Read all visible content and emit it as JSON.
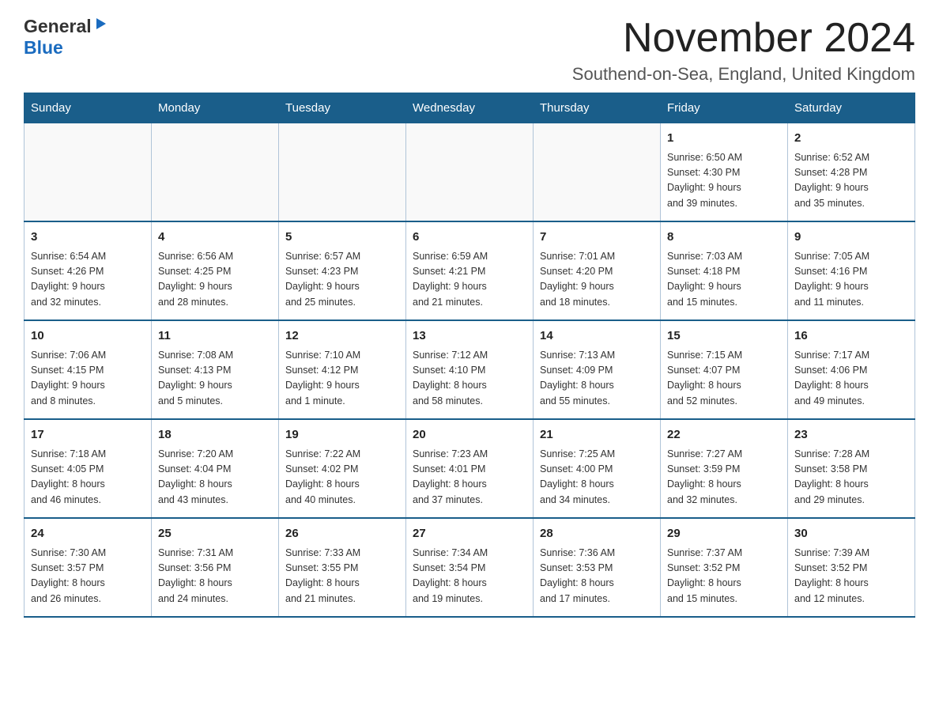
{
  "logo": {
    "line1": "General",
    "line2": "Blue"
  },
  "header": {
    "month": "November 2024",
    "location": "Southend-on-Sea, England, United Kingdom"
  },
  "days_of_week": [
    "Sunday",
    "Monday",
    "Tuesday",
    "Wednesday",
    "Thursday",
    "Friday",
    "Saturday"
  ],
  "weeks": [
    [
      {
        "day": "",
        "info": ""
      },
      {
        "day": "",
        "info": ""
      },
      {
        "day": "",
        "info": ""
      },
      {
        "day": "",
        "info": ""
      },
      {
        "day": "",
        "info": ""
      },
      {
        "day": "1",
        "info": "Sunrise: 6:50 AM\nSunset: 4:30 PM\nDaylight: 9 hours\nand 39 minutes."
      },
      {
        "day": "2",
        "info": "Sunrise: 6:52 AM\nSunset: 4:28 PM\nDaylight: 9 hours\nand 35 minutes."
      }
    ],
    [
      {
        "day": "3",
        "info": "Sunrise: 6:54 AM\nSunset: 4:26 PM\nDaylight: 9 hours\nand 32 minutes."
      },
      {
        "day": "4",
        "info": "Sunrise: 6:56 AM\nSunset: 4:25 PM\nDaylight: 9 hours\nand 28 minutes."
      },
      {
        "day": "5",
        "info": "Sunrise: 6:57 AM\nSunset: 4:23 PM\nDaylight: 9 hours\nand 25 minutes."
      },
      {
        "day": "6",
        "info": "Sunrise: 6:59 AM\nSunset: 4:21 PM\nDaylight: 9 hours\nand 21 minutes."
      },
      {
        "day": "7",
        "info": "Sunrise: 7:01 AM\nSunset: 4:20 PM\nDaylight: 9 hours\nand 18 minutes."
      },
      {
        "day": "8",
        "info": "Sunrise: 7:03 AM\nSunset: 4:18 PM\nDaylight: 9 hours\nand 15 minutes."
      },
      {
        "day": "9",
        "info": "Sunrise: 7:05 AM\nSunset: 4:16 PM\nDaylight: 9 hours\nand 11 minutes."
      }
    ],
    [
      {
        "day": "10",
        "info": "Sunrise: 7:06 AM\nSunset: 4:15 PM\nDaylight: 9 hours\nand 8 minutes."
      },
      {
        "day": "11",
        "info": "Sunrise: 7:08 AM\nSunset: 4:13 PM\nDaylight: 9 hours\nand 5 minutes."
      },
      {
        "day": "12",
        "info": "Sunrise: 7:10 AM\nSunset: 4:12 PM\nDaylight: 9 hours\nand 1 minute."
      },
      {
        "day": "13",
        "info": "Sunrise: 7:12 AM\nSunset: 4:10 PM\nDaylight: 8 hours\nand 58 minutes."
      },
      {
        "day": "14",
        "info": "Sunrise: 7:13 AM\nSunset: 4:09 PM\nDaylight: 8 hours\nand 55 minutes."
      },
      {
        "day": "15",
        "info": "Sunrise: 7:15 AM\nSunset: 4:07 PM\nDaylight: 8 hours\nand 52 minutes."
      },
      {
        "day": "16",
        "info": "Sunrise: 7:17 AM\nSunset: 4:06 PM\nDaylight: 8 hours\nand 49 minutes."
      }
    ],
    [
      {
        "day": "17",
        "info": "Sunrise: 7:18 AM\nSunset: 4:05 PM\nDaylight: 8 hours\nand 46 minutes."
      },
      {
        "day": "18",
        "info": "Sunrise: 7:20 AM\nSunset: 4:04 PM\nDaylight: 8 hours\nand 43 minutes."
      },
      {
        "day": "19",
        "info": "Sunrise: 7:22 AM\nSunset: 4:02 PM\nDaylight: 8 hours\nand 40 minutes."
      },
      {
        "day": "20",
        "info": "Sunrise: 7:23 AM\nSunset: 4:01 PM\nDaylight: 8 hours\nand 37 minutes."
      },
      {
        "day": "21",
        "info": "Sunrise: 7:25 AM\nSunset: 4:00 PM\nDaylight: 8 hours\nand 34 minutes."
      },
      {
        "day": "22",
        "info": "Sunrise: 7:27 AM\nSunset: 3:59 PM\nDaylight: 8 hours\nand 32 minutes."
      },
      {
        "day": "23",
        "info": "Sunrise: 7:28 AM\nSunset: 3:58 PM\nDaylight: 8 hours\nand 29 minutes."
      }
    ],
    [
      {
        "day": "24",
        "info": "Sunrise: 7:30 AM\nSunset: 3:57 PM\nDaylight: 8 hours\nand 26 minutes."
      },
      {
        "day": "25",
        "info": "Sunrise: 7:31 AM\nSunset: 3:56 PM\nDaylight: 8 hours\nand 24 minutes."
      },
      {
        "day": "26",
        "info": "Sunrise: 7:33 AM\nSunset: 3:55 PM\nDaylight: 8 hours\nand 21 minutes."
      },
      {
        "day": "27",
        "info": "Sunrise: 7:34 AM\nSunset: 3:54 PM\nDaylight: 8 hours\nand 19 minutes."
      },
      {
        "day": "28",
        "info": "Sunrise: 7:36 AM\nSunset: 3:53 PM\nDaylight: 8 hours\nand 17 minutes."
      },
      {
        "day": "29",
        "info": "Sunrise: 7:37 AM\nSunset: 3:52 PM\nDaylight: 8 hours\nand 15 minutes."
      },
      {
        "day": "30",
        "info": "Sunrise: 7:39 AM\nSunset: 3:52 PM\nDaylight: 8 hours\nand 12 minutes."
      }
    ]
  ]
}
